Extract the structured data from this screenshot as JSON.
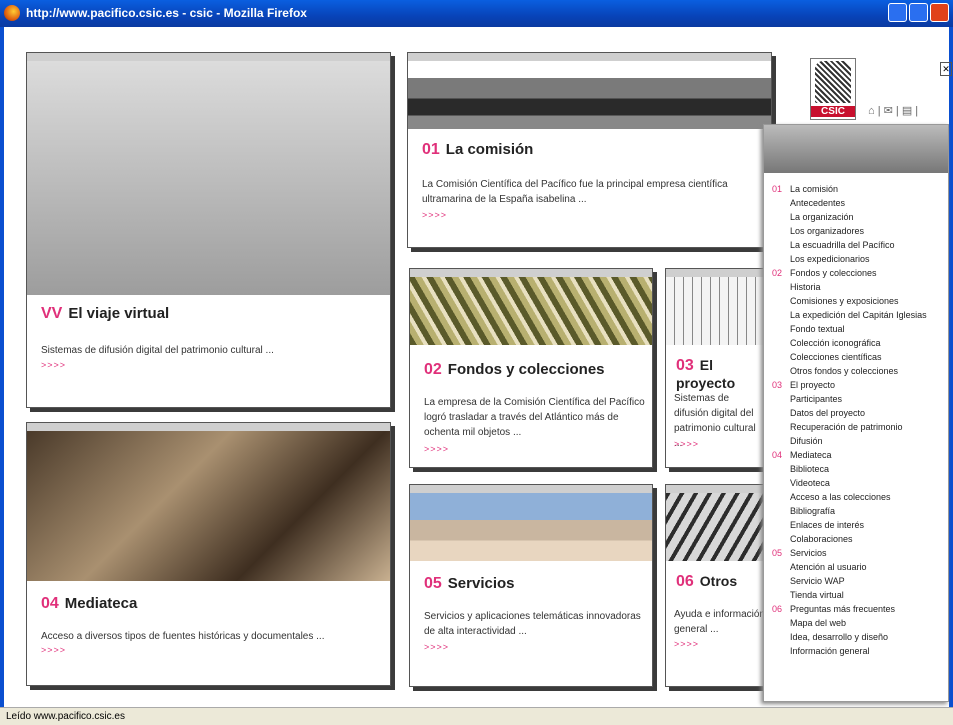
{
  "window": {
    "title": "http://www.pacifico.csic.es - csic - Mozilla Firefox"
  },
  "status": {
    "text": "Leído www.pacifico.csic.es"
  },
  "logo": {
    "text": "CSIC"
  },
  "cards": {
    "vv": {
      "num": "VV",
      "title": "El viaje virtual",
      "desc": "Sistemas de difusión digital del patrimonio cultural ...",
      "more": ">>>>"
    },
    "c01": {
      "num": "01",
      "title": "La comisión",
      "desc": "La Comisión Científica del Pacífico fue la principal empresa científica ultramarina de la España isabelina ...",
      "more": ">>>>"
    },
    "c02": {
      "num": "02",
      "title": "Fondos y colecciones",
      "desc": "La empresa de la Comisión Científica del Pacífico logró trasladar a través del Atlántico más de ochenta mil objetos ...",
      "more": ">>>>"
    },
    "c03": {
      "num": "03",
      "title": "El proyecto",
      "desc": "Sistemas de difusión digital del patrimonio cultural ...",
      "more": ">>>>"
    },
    "c04": {
      "num": "04",
      "title": "Mediateca",
      "desc": "Acceso a diversos tipos de fuentes históricas y documentales ...",
      "more": ">>>>"
    },
    "c05": {
      "num": "05",
      "title": "Servicios",
      "desc": "Servicios y aplicaciones telemáticas innovadoras de alta interactividad ...",
      "more": ">>>>"
    },
    "c06": {
      "num": "06",
      "title": "Otros",
      "desc": "Ayuda e información general ...",
      "more": ">>>>"
    }
  },
  "menu": {
    "items": [
      {
        "n": "01",
        "label": "La comisión"
      },
      {
        "n": "",
        "label": "Antecedentes"
      },
      {
        "n": "",
        "label": "La organización"
      },
      {
        "n": "",
        "label": "Los organizadores"
      },
      {
        "n": "",
        "label": "La escuadrilla del Pacífico"
      },
      {
        "n": "",
        "label": "Los expedicionarios"
      },
      {
        "n": "02",
        "label": "Fondos y colecciones"
      },
      {
        "n": "",
        "label": "Historia"
      },
      {
        "n": "",
        "label": "Comisiones y exposiciones"
      },
      {
        "n": "",
        "label": "La expedición del Capitán Iglesias"
      },
      {
        "n": "",
        "label": "Fondo textual"
      },
      {
        "n": "",
        "label": "Colección iconográfica"
      },
      {
        "n": "",
        "label": "Colecciones científicas"
      },
      {
        "n": "",
        "label": "Otros fondos y colecciones"
      },
      {
        "n": "03",
        "label": "El proyecto"
      },
      {
        "n": "",
        "label": "Participantes"
      },
      {
        "n": "",
        "label": "Datos del proyecto"
      },
      {
        "n": "",
        "label": "Recuperación de patrimonio"
      },
      {
        "n": "",
        "label": "Difusión"
      },
      {
        "n": "04",
        "label": "Mediateca"
      },
      {
        "n": "",
        "label": "Biblioteca"
      },
      {
        "n": "",
        "label": "Videoteca"
      },
      {
        "n": "",
        "label": "Acceso a las colecciones"
      },
      {
        "n": "",
        "label": "Bibliografía"
      },
      {
        "n": "",
        "label": "Enlaces de interés"
      },
      {
        "n": "",
        "label": "Colaboraciones"
      },
      {
        "n": "05",
        "label": "Servicios"
      },
      {
        "n": "",
        "label": "Atención al usuario"
      },
      {
        "n": "",
        "label": "Servicio WAP"
      },
      {
        "n": "",
        "label": "Tienda virtual"
      },
      {
        "n": "06",
        "label": "Preguntas más frecuentes"
      },
      {
        "n": "",
        "label": "Mapa del web"
      },
      {
        "n": "",
        "label": "Idea, desarrollo y diseño"
      },
      {
        "n": "",
        "label": "Información general"
      }
    ]
  },
  "colors": {
    "accent": "#e0307a",
    "titlebar": "#0a4fd0"
  }
}
